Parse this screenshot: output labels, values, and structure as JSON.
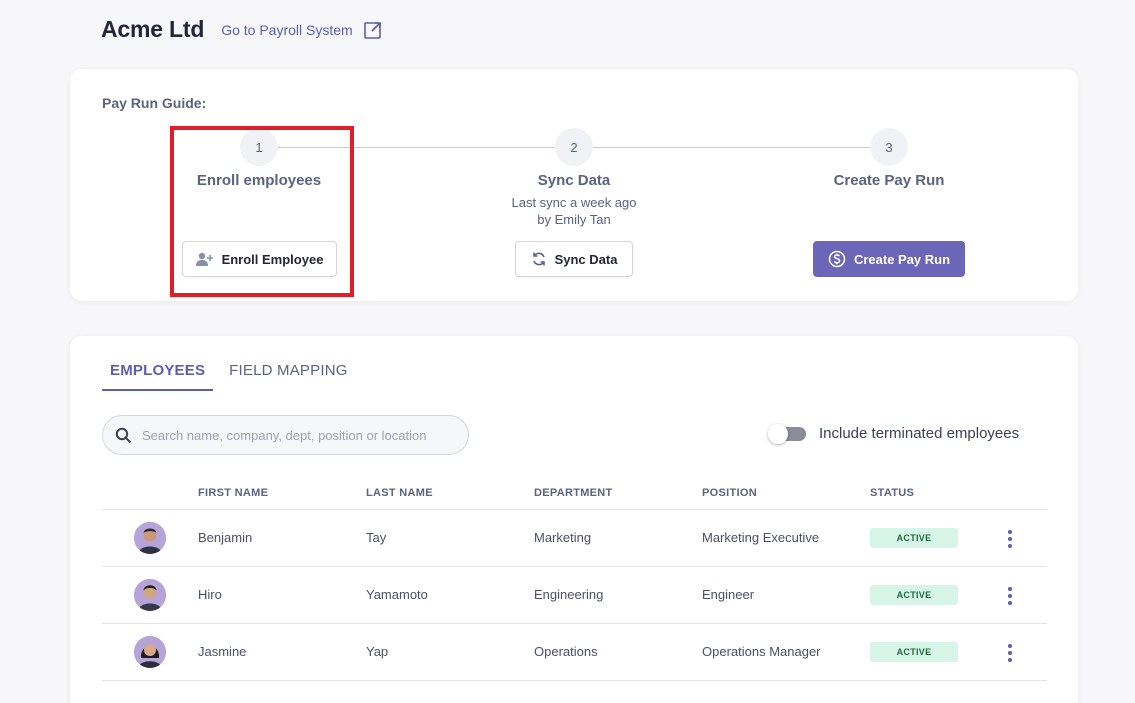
{
  "header": {
    "company": "Acme Ltd",
    "goto_link": "Go to Payroll System"
  },
  "guide": {
    "title": "Pay Run Guide:",
    "steps": [
      {
        "number": "1",
        "title": "Enroll employees",
        "subtitle": "",
        "button": "Enroll Employee",
        "icon": "add-user-icon"
      },
      {
        "number": "2",
        "title": "Sync Data",
        "subtitle_line1": "Last sync a week ago",
        "subtitle_line2": "by Emily Tan",
        "button": "Sync Data",
        "icon": "sync-icon"
      },
      {
        "number": "3",
        "title": "Create Pay Run",
        "subtitle": "",
        "button": "Create Pay Run",
        "icon": "dollar-circle-icon"
      }
    ]
  },
  "employees": {
    "tabs": [
      {
        "label": "EMPLOYEES",
        "active": true
      },
      {
        "label": "FIELD MAPPING",
        "active": false
      }
    ],
    "search_placeholder": "Search name, company, dept, position or location",
    "toggle_label": "Include terminated employees",
    "columns": [
      "FIRST NAME",
      "LAST NAME",
      "DEPARTMENT",
      "POSITION",
      "STATUS"
    ],
    "rows": [
      {
        "first": "Benjamin",
        "last": "Tay",
        "department": "Marketing",
        "position": "Marketing Executive",
        "status": "ACTIVE"
      },
      {
        "first": "Hiro",
        "last": "Yamamoto",
        "department": "Engineering",
        "position": "Engineer",
        "status": "ACTIVE"
      },
      {
        "first": "Jasmine",
        "last": "Yap",
        "department": "Operations",
        "position": "Operations Manager",
        "status": "ACTIVE"
      }
    ]
  },
  "colors": {
    "accent": "#6b66b8",
    "link": "#5b5fb0",
    "highlight": "#e11d25",
    "active_badge_bg": "#d6f5e6"
  }
}
